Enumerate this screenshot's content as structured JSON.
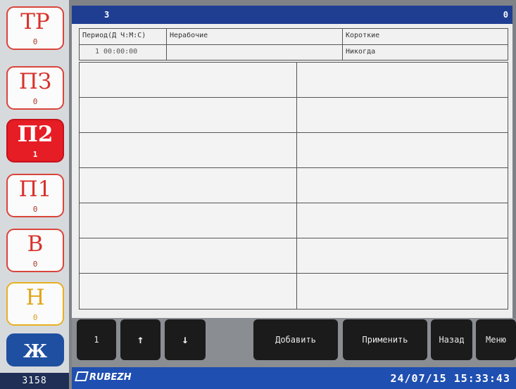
{
  "sidebar": {
    "buttons": [
      {
        "label": "ТР",
        "count": "0"
      },
      {
        "label": "ПЗ",
        "count": "0"
      },
      {
        "label": "П2",
        "count": "1"
      },
      {
        "label": "П1",
        "count": "0"
      },
      {
        "label": "В",
        "count": "0"
      },
      {
        "label": "Н",
        "count": "0"
      },
      {
        "label": "Ж",
        "count": "3158"
      }
    ]
  },
  "topbar": {
    "left_value": "3",
    "right_value": "0"
  },
  "header": {
    "col1_label": "Период(Д Ч:М:С)",
    "col1_value": "1 00:00:00",
    "col2_label": "Нерабочие",
    "col2_value": "",
    "col3_label": "Короткие",
    "col3_value": "Никогда"
  },
  "table": {
    "rows": 7,
    "cols": 2
  },
  "buttons": {
    "page": "1",
    "up": "↑",
    "down": "↓",
    "add": "Добавить",
    "apply": "Применить",
    "back": "Назад",
    "menu": "Меню"
  },
  "footer": {
    "brand": "RUBEZH",
    "datetime": "24/07/15 15:33:43"
  },
  "colors": {
    "accent_red": "#e61d25",
    "header_blue": "#1f3e92",
    "footer_blue": "#1f4fb0",
    "warning_yellow": "#e8b020"
  }
}
